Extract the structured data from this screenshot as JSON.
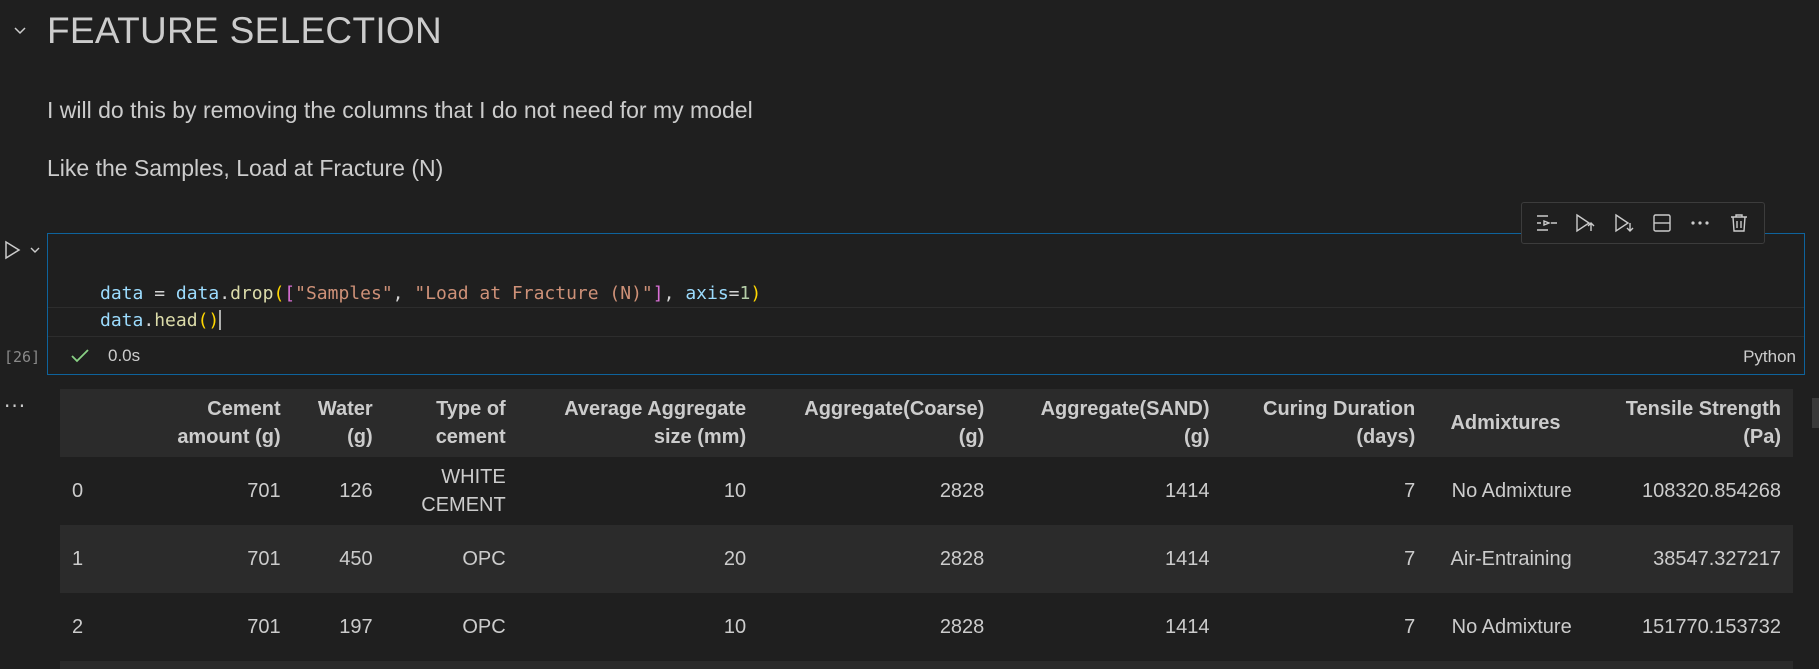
{
  "markdown": {
    "title": "FEATURE SELECTION",
    "paragraphs": [
      "I will do this by removing the columns that I do not need for my model",
      "Like the Samples, Load at Fracture (N)"
    ]
  },
  "toolbar": {
    "items": [
      "execute-above-icon",
      "execute-cell-and-above-icon",
      "execute-cell-and-below-icon",
      "split-cell-icon",
      "more-actions-icon",
      "delete-cell-icon"
    ]
  },
  "cell": {
    "execution_count": "[26]",
    "code": {
      "line1": {
        "a": "data",
        "b": " = ",
        "c": "data",
        "d": ".",
        "e": "drop",
        "f": "(",
        "g": "[",
        "h": "\"Samples\"",
        "i": ", ",
        "j": "\"Load at Fracture (N)\"",
        "k": "]",
        "l": ", ",
        "m": "axis",
        "n": "=",
        "o": "1",
        "p": ")"
      },
      "line2": {
        "a": "data",
        "b": ".",
        "c": "head",
        "d": "(",
        "e": ")"
      }
    },
    "status": {
      "exec_time": "0.0s",
      "language": "Python"
    }
  },
  "output": {
    "more": "...",
    "columns": [
      {
        "l1": "",
        "l2": ""
      },
      {
        "l1": "Cement",
        "l2": "amount (g)"
      },
      {
        "l1": "Water",
        "l2": "(g)"
      },
      {
        "l1": "Type of",
        "l2": "cement"
      },
      {
        "l1": "Average Aggregate",
        "l2": "size (mm)"
      },
      {
        "l1": "Aggregate(Coarse)",
        "l2": "(g)"
      },
      {
        "l1": "Aggregate(SAND)",
        "l2": "(g)"
      },
      {
        "l1": "Curing Duration",
        "l2": "(days)"
      },
      {
        "l1": "Admixtures",
        "l2": ""
      },
      {
        "l1": "Tensile Strength",
        "l2": "(Pa)"
      }
    ],
    "rows": [
      [
        "0",
        "701",
        "126",
        "WHITE CEMENT",
        "10",
        "2828",
        "1414",
        "7",
        "No Admixture",
        "108320.854268"
      ],
      [
        "1",
        "701",
        "450",
        "OPC",
        "20",
        "2828",
        "1414",
        "7",
        "Air-Entraining",
        "38547.327217"
      ],
      [
        "2",
        "701",
        "197",
        "OPC",
        "10",
        "2828",
        "1414",
        "7",
        "No Admixture",
        "151770.153732"
      ]
    ]
  }
}
